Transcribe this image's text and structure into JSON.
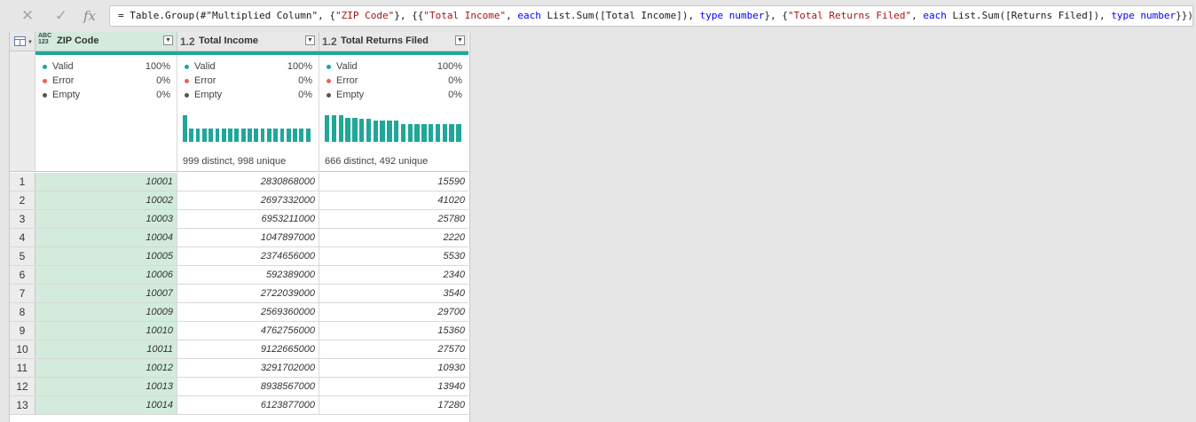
{
  "formula_bar": {
    "cancel_icon": "x-icon",
    "commit_icon": "check-icon",
    "fx_label": "fx",
    "tokens": [
      {
        "t": "= Table.Group(#\"Multiplied Column\", {",
        "k": "t"
      },
      {
        "t": "\"ZIP Code\"",
        "k": "s"
      },
      {
        "t": "}, {{",
        "k": "t"
      },
      {
        "t": "\"Total Income\"",
        "k": "s"
      },
      {
        "t": ", ",
        "k": "t"
      },
      {
        "t": "each",
        "k": "k"
      },
      {
        "t": " List.Sum([Total Income]), ",
        "k": "t"
      },
      {
        "t": "type number",
        "k": "k"
      },
      {
        "t": "}, {",
        "k": "t"
      },
      {
        "t": "\"Total Returns Filed\"",
        "k": "s"
      },
      {
        "t": ", ",
        "k": "t"
      },
      {
        "t": "each",
        "k": "k"
      },
      {
        "t": " List.Sum([Returns Filed]), ",
        "k": "t"
      },
      {
        "t": "type number",
        "k": "k"
      },
      {
        "t": "}})",
        "k": "t"
      }
    ]
  },
  "columns": [
    {
      "type_label": "ABC 123",
      "name": "ZIP Code",
      "quality": {
        "valid": "100%",
        "error": "0%",
        "empty": "0%"
      },
      "distinct_text": "",
      "histogram": []
    },
    {
      "type_label": "1.2",
      "name": "Total Income",
      "quality": {
        "valid": "100%",
        "error": "0%",
        "empty": "0%"
      },
      "distinct_text": "999 distinct, 998 unique",
      "histogram": [
        1,
        0.5,
        0.5,
        0.5,
        0.5,
        0.5,
        0.5,
        0.5,
        0.5,
        0.5,
        0.5,
        0.5,
        0.5,
        0.5,
        0.5,
        0.5,
        0.5,
        0.5,
        0.5,
        0.5
      ]
    },
    {
      "type_label": "1.2",
      "name": "Total Returns Filed",
      "quality": {
        "valid": "100%",
        "error": "0%",
        "empty": "0%"
      },
      "distinct_text": "666 distinct, 492 unique",
      "histogram": [
        1,
        1,
        1,
        0.9,
        0.9,
        0.85,
        0.85,
        0.8,
        0.8,
        0.8,
        0.8,
        0.65,
        0.65,
        0.65,
        0.65,
        0.65,
        0.65,
        0.65,
        0.65,
        0.65
      ]
    }
  ],
  "quality_labels": {
    "valid": "Valid",
    "error": "Error",
    "empty": "Empty"
  },
  "quality_colors": {
    "valid": "#1fa79a",
    "error": "#e8635a",
    "empty": "#555555"
  },
  "rows": [
    [
      "1",
      "10001",
      "2830868000",
      "15590"
    ],
    [
      "2",
      "10002",
      "2697332000",
      "41020"
    ],
    [
      "3",
      "10003",
      "6953211000",
      "25780"
    ],
    [
      "4",
      "10004",
      "1047897000",
      "2220"
    ],
    [
      "5",
      "10005",
      "2374656000",
      "5530"
    ],
    [
      "6",
      "10006",
      "592389000",
      "2340"
    ],
    [
      "7",
      "10007",
      "2722039000",
      "3540"
    ],
    [
      "8",
      "10009",
      "2569360000",
      "29700"
    ],
    [
      "9",
      "10010",
      "4762756000",
      "15360"
    ],
    [
      "10",
      "10011",
      "9122665000",
      "27570"
    ],
    [
      "11",
      "10012",
      "3291702000",
      "10930"
    ],
    [
      "12",
      "10013",
      "8938567000",
      "13940"
    ],
    [
      "13",
      "10014",
      "6123877000",
      "17280"
    ]
  ]
}
